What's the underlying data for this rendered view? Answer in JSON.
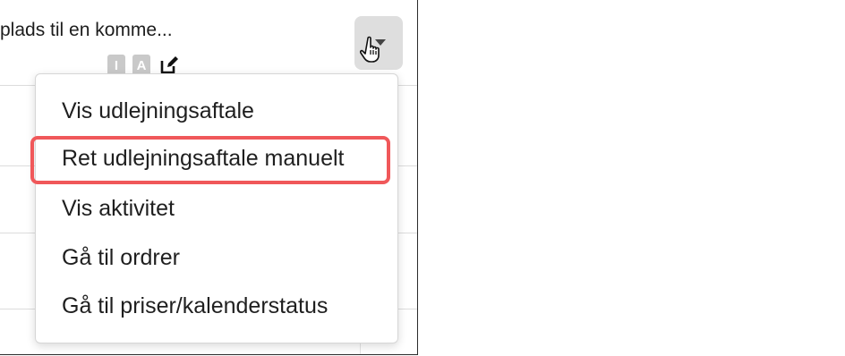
{
  "cell": {
    "title": "plads til en komme...",
    "badges": [
      "I",
      "A"
    ]
  },
  "menu": {
    "items": [
      {
        "label": "Vis udlejningsaftale"
      },
      {
        "label": "Ret udlejningsaftale manuelt",
        "highlighted": true
      },
      {
        "label": "Vis aktivitet"
      },
      {
        "label": "Gå til ordrer"
      },
      {
        "label": "Gå til priser/kalenderstatus"
      }
    ]
  },
  "colors": {
    "highlight_border": "#f0585a",
    "toggle_bg": "#dedede",
    "badge_bg": "#c9c9c9"
  },
  "icons": [
    "edit-icon",
    "caret-down-icon",
    "hand-pointer-icon"
  ]
}
